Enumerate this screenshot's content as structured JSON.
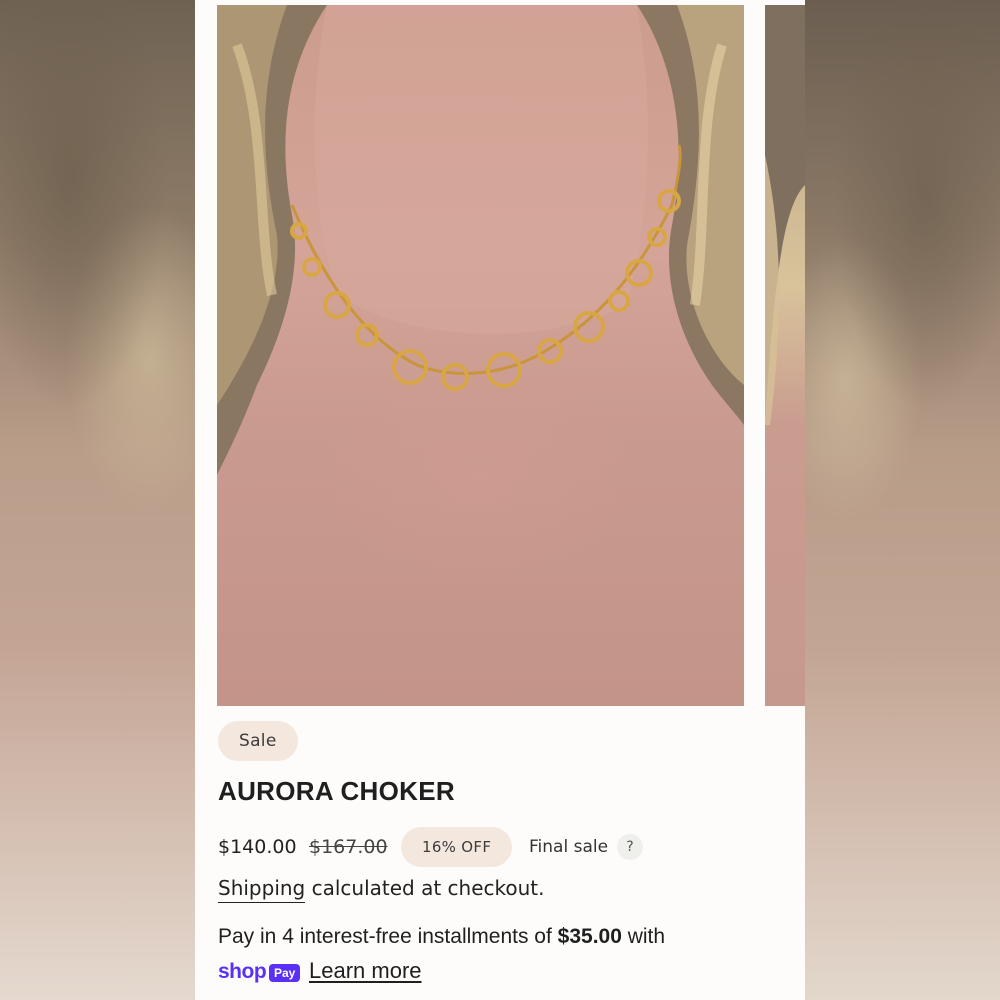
{
  "product": {
    "sale_badge": "Sale",
    "title": "AURORA CHOKER",
    "price_current": "$140.00",
    "price_original": "$167.00",
    "discount_badge": "16% OFF",
    "final_sale_label": "Final sale",
    "help_icon_glyph": "?"
  },
  "shipping": {
    "link_text": "Shipping",
    "rest_text": " calculated at checkout."
  },
  "installments": {
    "prefix": "Pay in 4 interest-free installments of ",
    "amount": "$35.00",
    "suffix": " with",
    "shop_logo_text": "shop",
    "pay_badge_text": "Pay",
    "learn_more": "Learn more"
  },
  "icons": {
    "help": "question-mark-icon",
    "shop_pay": "shop-pay-logo"
  },
  "colors": {
    "badge_bg": "#f3e7de",
    "shop_pay_purple": "#5a31f4",
    "text": "#1f1f1f",
    "panel_bg": "#fdfcfb"
  }
}
